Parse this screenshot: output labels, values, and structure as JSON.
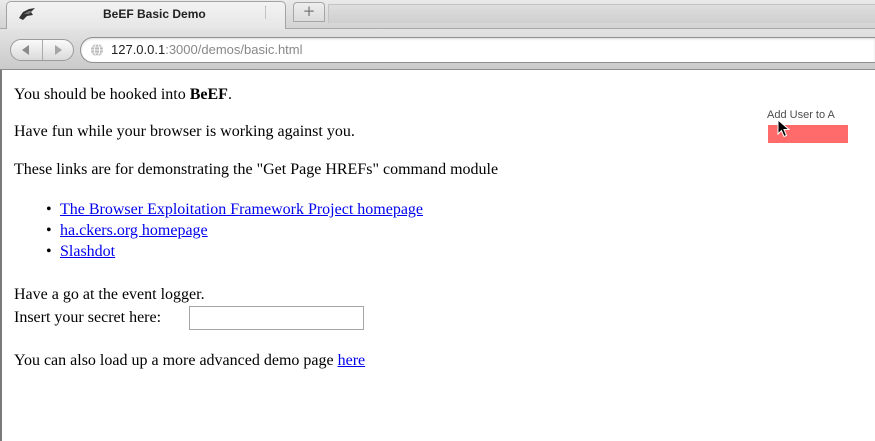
{
  "browser": {
    "tab_title": "BeEF Basic Demo",
    "newtab_label": "+",
    "url_host": "127.0.0.1",
    "url_rest": ":3000/demos/basic.html"
  },
  "page": {
    "intro_prefix": "You should be hooked into ",
    "intro_bold": "BeEF",
    "intro_suffix": ".",
    "fun_text": "Have fun while your browser is working against you.",
    "links_intro": "These links are for demonstrating the \"Get Page HREFs\" command module",
    "bullet": "•",
    "links": [
      "The Browser Exploitation Framework Project homepage",
      "ha.ckers.org homepage",
      "Slashdot"
    ],
    "event_logger_text": "Have a go at the event logger.",
    "secret_label": "Insert your secret here:",
    "secret_value": "",
    "advanced_prefix": "You can also load up a more advanced demo page ",
    "advanced_link": "here"
  },
  "widget": {
    "add_user_label": "Add User to A",
    "button_color": "#ff6b6b"
  },
  "colors": {
    "link": "#0000ee",
    "text": "#000000"
  }
}
